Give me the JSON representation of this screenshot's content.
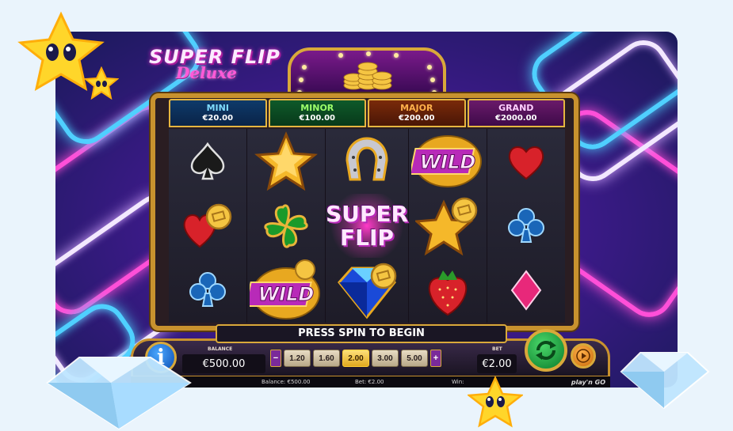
{
  "game": {
    "logo_line1": "SUPER FLIP",
    "logo_line2": "Deluxe"
  },
  "jackpots": [
    {
      "name": "MINI",
      "value": "€20.00"
    },
    {
      "name": "MINOR",
      "value": "€100.00"
    },
    {
      "name": "MAJOR",
      "value": "€200.00"
    },
    {
      "name": "GRAND",
      "value": "€2000.00"
    }
  ],
  "reels": [
    [
      "spade",
      "heart-coin",
      "club"
    ],
    [
      "star",
      "clover",
      "wild-coin"
    ],
    [
      "horseshoe",
      "super-flip",
      "diamond-coin"
    ],
    [
      "wild",
      "star-coin",
      "strawberry"
    ],
    [
      "heart",
      "club",
      "diamond"
    ]
  ],
  "symbols": {
    "wild": "WILD",
    "super_flip_top": "SUPER",
    "super_flip_bottom": "FLIP"
  },
  "message": "PRESS SPIN TO BEGIN",
  "controls": {
    "info_label": "i",
    "balance_label": "BALANCE",
    "balance_value": "€500.00",
    "bet_label": "BET",
    "bet_value": "€2.00",
    "minus": "−",
    "plus": "+",
    "bet_options": [
      "1.20",
      "1.60",
      "2.00",
      "3.00",
      "5.00"
    ],
    "selected_bet": "2.00"
  },
  "status_bar": {
    "balance": "Balance: €500.00",
    "bet": "Bet: €2.00",
    "win": "Win:",
    "brand": "play'n GO"
  },
  "colors": {
    "gold": "#d9a93a",
    "neon_pink": "#ff4fd8",
    "neon_blue": "#4fd0ff",
    "spin_green": "#2aa84a"
  }
}
